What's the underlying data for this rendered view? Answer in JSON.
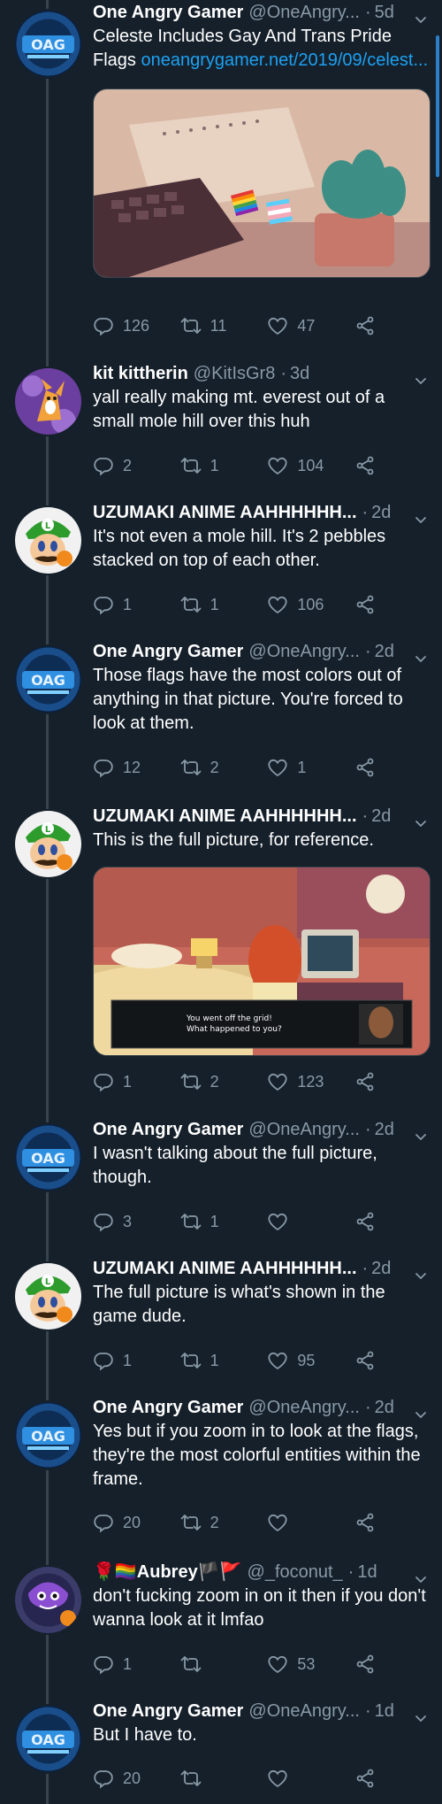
{
  "tweets": [
    {
      "name": "One Angry Gamer",
      "handle": "@OneAngry...",
      "time": "5d",
      "text": "Celeste Includes Gay And Trans Pride Flags ",
      "link": "oneangrygamer.net/2019/09/celest...",
      "replies": "126",
      "retweets": "11",
      "likes": "47",
      "avatar": "oag"
    },
    {
      "name": "kit kittherin",
      "handle": "@KitIsGr8",
      "time": "3d",
      "text": "yall really making mt. everest out of a small mole hill over this huh",
      "replies": "2",
      "retweets": "1",
      "likes": "104",
      "avatar": "kit"
    },
    {
      "name": "UZUMAKI ANIME AAHHHHHH...",
      "handle": "",
      "time": "2d",
      "text": "It's not even a mole hill. It's 2 pebbles stacked on top of each other.",
      "replies": "1",
      "retweets": "1",
      "likes": "106",
      "avatar": "luigi"
    },
    {
      "name": "One Angry Gamer",
      "handle": "@OneAngry...",
      "time": "2d",
      "text": "Those flags have the most colors out of anything in that picture. You're forced to look at them.",
      "replies": "12",
      "retweets": "2",
      "likes": "1",
      "avatar": "oag"
    },
    {
      "name": "UZUMAKI ANIME AAHHHHHH...",
      "handle": "",
      "time": "2d",
      "text": "This is the full picture, for reference.",
      "replies": "1",
      "retweets": "2",
      "likes": "123",
      "avatar": "luigi",
      "dialog_line1": "You went off the grid!",
      "dialog_line2": "What happened to you?"
    },
    {
      "name": "One Angry Gamer",
      "handle": "@OneAngry...",
      "time": "2d",
      "text": "I wasn't talking about the full picture, though.",
      "replies": "3",
      "retweets": "1",
      "likes": "",
      "avatar": "oag"
    },
    {
      "name": "UZUMAKI ANIME AAHHHHHH...",
      "handle": "",
      "time": "2d",
      "text": "The full picture is what's shown in the game dude.",
      "replies": "1",
      "retweets": "1",
      "likes": "95",
      "avatar": "luigi"
    },
    {
      "name": "One Angry Gamer",
      "handle": "@OneAngry...",
      "time": "2d",
      "text": "Yes but if you zoom in to look at the flags, they're the most colorful entities within the frame.",
      "replies": "20",
      "retweets": "2",
      "likes": "",
      "avatar": "oag"
    },
    {
      "name": "🌹🏳️‍🌈Aubrey🏴🚩",
      "handle": "@_foconut_",
      "time": "1d",
      "text": "don't fucking zoom in on it then if you don't wanna look at it lmfao",
      "replies": "1",
      "retweets": "",
      "likes": "53",
      "avatar": "aubrey"
    },
    {
      "name": "One Angry Gamer",
      "handle": "@OneAngry...",
      "time": "1d",
      "text": "But I have to.",
      "replies": "20",
      "retweets": "",
      "likes": "",
      "avatar": "oag"
    }
  ],
  "dot": "·",
  "colors": {
    "background": "#15202b",
    "muted": "#8899a6",
    "link": "#1da1f2",
    "line": "#38444d"
  }
}
